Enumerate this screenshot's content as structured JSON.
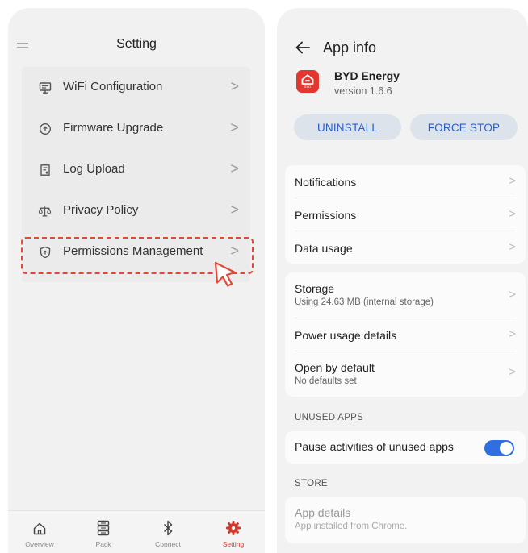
{
  "left_screen": {
    "title": "Setting",
    "items": [
      {
        "label": "WiFi Configuration",
        "icon": "monitor-icon"
      },
      {
        "label": "Firmware Upgrade",
        "icon": "upload-circle-icon"
      },
      {
        "label": "Log Upload",
        "icon": "log-file-icon"
      },
      {
        "label": "Privacy Policy",
        "icon": "scale-icon"
      },
      {
        "label": "Permissions Management",
        "icon": "shield-icon"
      }
    ],
    "chevron": ">",
    "tabs": [
      {
        "label": "Overview",
        "icon": "home-icon"
      },
      {
        "label": "Pack",
        "icon": "battery-pack-icon"
      },
      {
        "label": "Connect",
        "icon": "bluetooth-icon"
      },
      {
        "label": "Setting",
        "icon": "gear-icon"
      }
    ],
    "active_tab_color": "#d03a2c",
    "highlight_color": "#e2483a"
  },
  "right_screen": {
    "title": "App info",
    "app_name": "BYD Energy",
    "app_version": "version 1.6.6",
    "logo_text": "BYD",
    "buttons": {
      "uninstall": "UNINSTALL",
      "force_stop": "FORCE STOP"
    },
    "group1": [
      {
        "title": "Notifications"
      },
      {
        "title": "Permissions"
      },
      {
        "title": "Data usage"
      }
    ],
    "group2": [
      {
        "title": "Storage",
        "subtitle": "Using 24.63 MB (internal storage)"
      },
      {
        "title": "Power usage details"
      },
      {
        "title": "Open by default",
        "subtitle": "No defaults set"
      }
    ],
    "unused_apps_header": "UNUSED APPS",
    "pause_label": "Pause activities of unused apps",
    "pause_enabled": true,
    "store_header": "STORE",
    "app_details_title": "App details",
    "app_details_sub": "App installed from Chrome.",
    "chevron": ">",
    "accent_color": "#2f6fe0"
  }
}
